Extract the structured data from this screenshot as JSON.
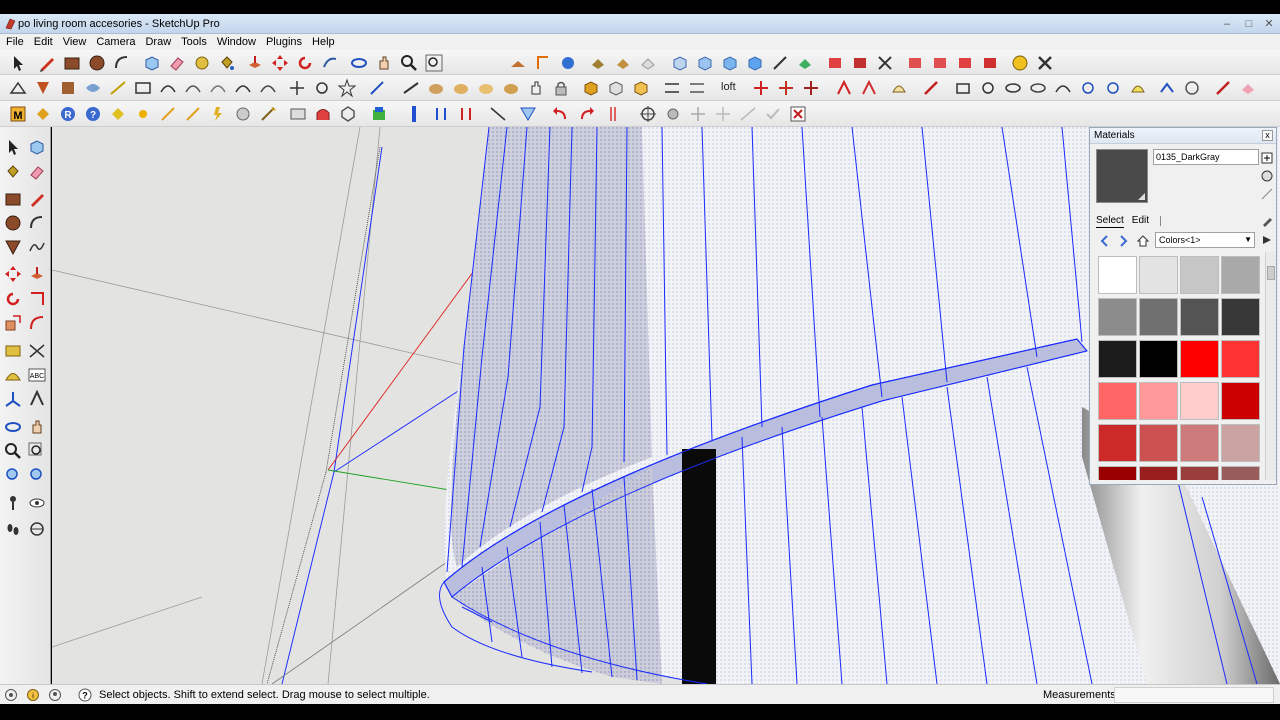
{
  "window": {
    "title": "po living room accesories - SketchUp Pro",
    "minimize": "‒",
    "maximize": "□",
    "close": "✕"
  },
  "menu": [
    "File",
    "Edit",
    "View",
    "Camera",
    "Draw",
    "Tools",
    "Window",
    "Plugins",
    "Help"
  ],
  "toolbar": {
    "loft_label": "loft"
  },
  "materials": {
    "title": "Materials",
    "close": "x",
    "current_material": "0135_DarkGray",
    "current_color": "#4a4a4a",
    "tabs": [
      "Select",
      "Edit"
    ],
    "library": "Colors<1>",
    "swatches": [
      "#ffffff",
      "#e3e3e3",
      "#c6c6c6",
      "#a9a9a9",
      "#8c8c8c",
      "#707070",
      "#545454",
      "#383838",
      "#1c1c1c",
      "#000000",
      "#ff0000",
      "#ff3333",
      "#ff6666",
      "#ff9999",
      "#ffcccc",
      "#cc0000",
      "#cc2929",
      "#cc5252",
      "#cc7a7a",
      "#cca3a3",
      "#990000",
      "#991f1f",
      "#993d3d",
      "#995c5c"
    ]
  },
  "status": {
    "message": "Select objects. Shift to extend select. Drag mouse to select multiple.",
    "measurements_label": "Measurements",
    "measurements_value": ""
  },
  "colors": {
    "edge_selected": "#1a2bff",
    "axis_red": "#e02020",
    "axis_green": "#20a020",
    "viewport_bg": "#e3e4e2"
  }
}
